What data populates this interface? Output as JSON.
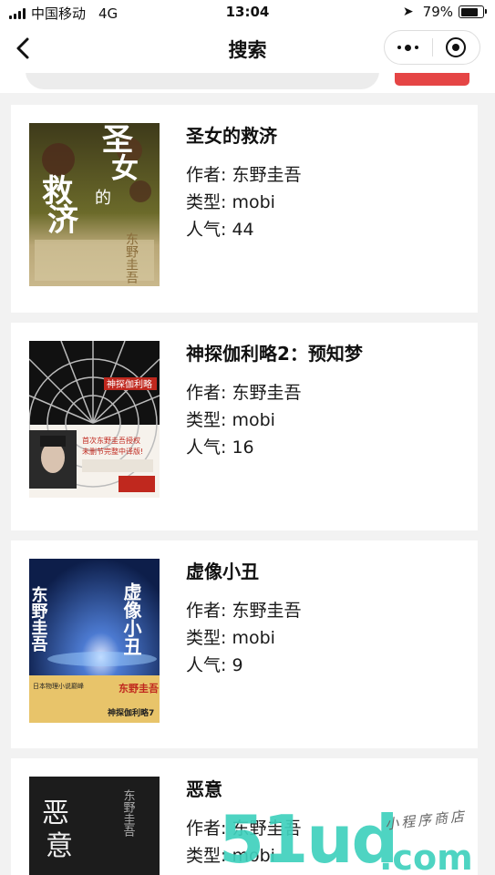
{
  "status_bar": {
    "carrier": "中国移动",
    "network": "4G",
    "time": "13:04",
    "battery": "79%",
    "battery_level": 0.79
  },
  "nav": {
    "title": "搜索"
  },
  "labels": {
    "author": "作者: ",
    "type": "类型: ",
    "popularity": "人气: "
  },
  "books": [
    {
      "title": "圣女的救济",
      "author": "东野圭吾",
      "type": "mobi",
      "popularity": "44",
      "cover_text": "圣女的救济",
      "cover_author": "东野圭吾"
    },
    {
      "title": "神探伽利略2：预知梦",
      "author": "东野圭吾",
      "type": "mobi",
      "popularity": "16",
      "cover_text": "神探伽利略",
      "cover_banner": "首次东野圭吾授权 未删节完整中译版!"
    },
    {
      "title": "虚像小丑",
      "author": "东野圭吾",
      "type": "mobi",
      "popularity": "9",
      "cover_text": "虚像小丑",
      "cover_author": "东野圭吾",
      "cover_series": "神探伽利略7"
    },
    {
      "title": "恶意",
      "author": "东野圭吾",
      "type": "mobi",
      "cover_text": "恶意",
      "cover_author": "东野圭吾"
    }
  ],
  "watermark": {
    "main": "51ud",
    "suffix": ".com",
    "tagline": "小程序商店"
  }
}
